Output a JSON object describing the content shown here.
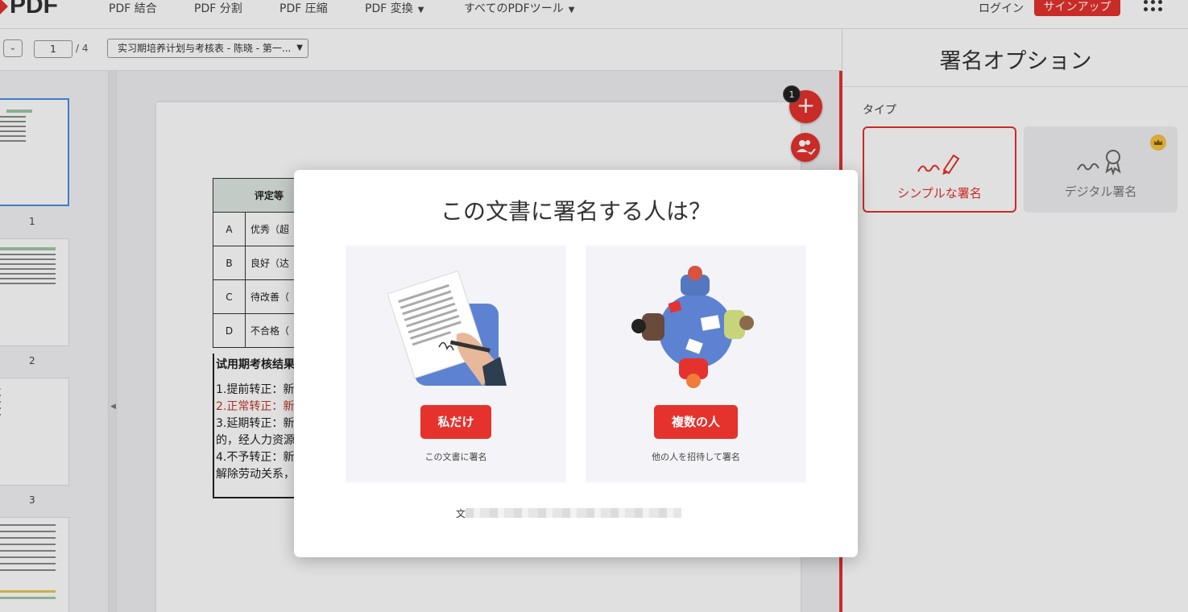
{
  "nav": {
    "logo": "PDF",
    "items": [
      "PDF 結合",
      "PDF 分割",
      "PDF 圧縮",
      "PDF 変換",
      "すべてのPDFツール"
    ],
    "login": "ログイン",
    "signup": "サインアップ"
  },
  "toolbar": {
    "page_current": "1",
    "page_total": "/ 4",
    "document_name": "实习期培养计划与考核表 - 陈晓 - 第一..."
  },
  "thumbnails": {
    "pages": [
      "1",
      "2",
      "3"
    ]
  },
  "document": {
    "table": {
      "header": "评定等",
      "rows": [
        {
          "grade": "A",
          "desc": "优秀（超"
        },
        {
          "grade": "B",
          "desc": "良好（达"
        },
        {
          "grade": "C",
          "desc": "待改善（"
        },
        {
          "grade": "D",
          "desc": "不合格（"
        }
      ]
    },
    "result": {
      "heading": "试用期考核结果",
      "lines": [
        "1.提前转正：新",
        "2.正常转正：新",
        "3.延期转正：新",
        "的，经人力资源",
        "4.不予转正：新",
        "解除劳动关系，"
      ]
    },
    "badge_count": "1"
  },
  "right_panel": {
    "title": "署名オプション",
    "type_label": "タイプ",
    "options": [
      {
        "label": "シンプルな署名",
        "selected": true
      },
      {
        "label": "デジタル署名",
        "selected": false,
        "premium": true
      }
    ]
  },
  "modal": {
    "title": "この文書に署名する人は？",
    "cards": [
      {
        "button": "私だけ",
        "subtitle": "この文書に署名"
      },
      {
        "button": "複数の人",
        "subtitle": "他の人を招待して署名"
      }
    ],
    "footer_prefix": "文"
  },
  "colors": {
    "accent": "#e5322d",
    "selected_thumb": "#4a90e2"
  }
}
